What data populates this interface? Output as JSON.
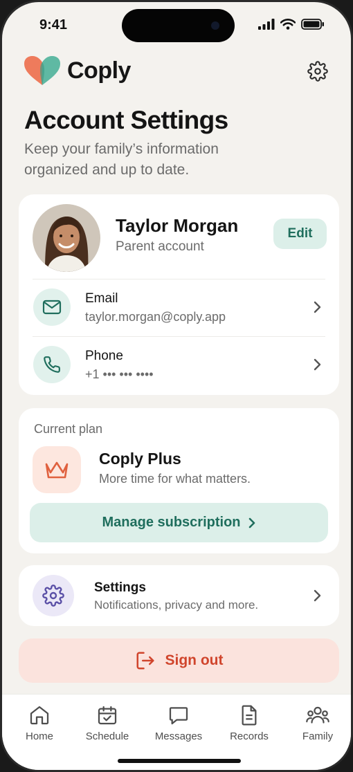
{
  "status_bar": {
    "time": "9:41"
  },
  "header": {
    "brand": "Coply"
  },
  "page": {
    "title": "Account Settings",
    "subtitle": "Keep your family’s information organized and up to date."
  },
  "profile": {
    "name": "Taylor Morgan",
    "role": "Parent account",
    "edit_label": "Edit",
    "email_label": "Email",
    "email_value": "taylor.morgan@coply.app",
    "phone_label": "Phone",
    "phone_value": "+1 ••• ••• ••••"
  },
  "plan": {
    "section_label": "Current plan",
    "name": "Coply Plus",
    "tagline": "More time for what matters.",
    "manage_label": "Manage subscription"
  },
  "settings_row": {
    "title": "Settings",
    "subtitle": "Notifications, privacy and more."
  },
  "signout": {
    "label": "Sign out"
  },
  "tabs": [
    {
      "label": "Home",
      "icon": "home-icon"
    },
    {
      "label": "Schedule",
      "icon": "calendar-check-icon"
    },
    {
      "label": "Messages",
      "icon": "message-icon"
    },
    {
      "label": "Records",
      "icon": "document-icon"
    },
    {
      "label": "Family",
      "icon": "family-icon"
    }
  ],
  "colors": {
    "background": "#f4f2ee",
    "accent_green": "#1f6e5d",
    "accent_green_bg": "#dcefe9",
    "accent_orange": "#e0613f",
    "signout_red": "#d0452c",
    "signout_bg": "#fbe3dd",
    "settings_purple": "#5a4fa6"
  }
}
